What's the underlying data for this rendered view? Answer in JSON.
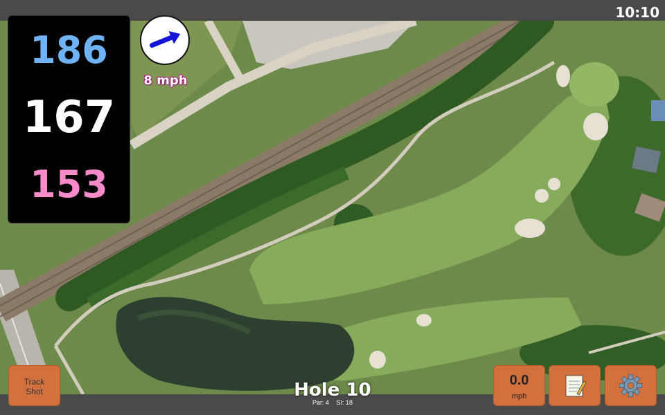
{
  "status": {
    "time": "10:10"
  },
  "distances": {
    "back": "186",
    "middle": "167",
    "front": "153"
  },
  "wind": {
    "speed": "8 mph",
    "icon": "wind-arrow-icon"
  },
  "buttons": {
    "track_shot_line1": "Track",
    "track_shot_line2": "Shot",
    "speed_value": "0.0",
    "speed_unit": "mph",
    "notes_icon": "notepad-icon",
    "settings_icon": "gear-icon"
  },
  "hole": {
    "title": "Hole 10",
    "par": "Par: 4",
    "si": "SI: 18"
  },
  "colors": {
    "back": "#6fb3f5",
    "middle": "#ffffff",
    "front": "#f78ac8",
    "button": "#d2703e",
    "wind_text_outline": "#a0157a"
  }
}
